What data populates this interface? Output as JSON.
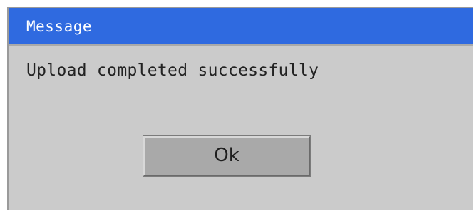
{
  "window": {
    "title": "Message",
    "message": "Upload completed successfully",
    "button_label": "Ok"
  },
  "colors": {
    "titlebar": "#2f6ae0",
    "dialog_bg": "#cbcbcb",
    "button_bg": "#a9a9a9"
  }
}
